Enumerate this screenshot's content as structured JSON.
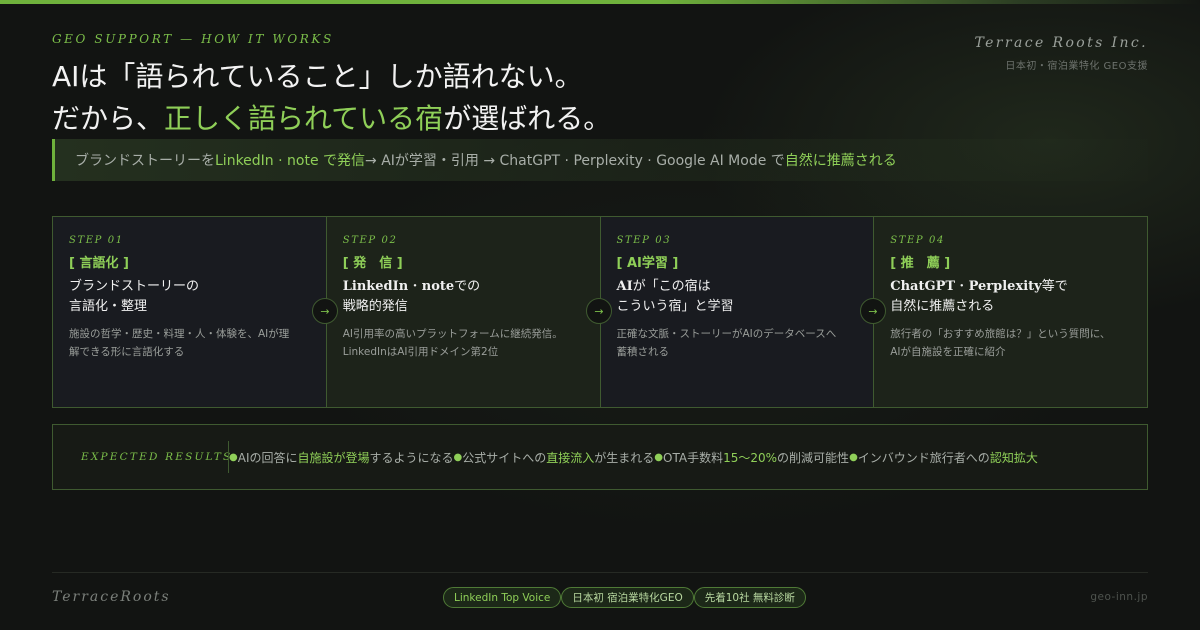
{
  "header": {
    "eyebrow": "GEO SUPPORT — HOW IT WORKS",
    "brand_name": "Terrace Roots Inc.",
    "brand_sub": "日本初・宿泊業特化 GEO支援",
    "headline_line1": "AIは「語られていること」しか語れない。",
    "headline_line2_pre": "だから、",
    "headline_line2_accent": "正しく語られている宿",
    "headline_line2_post": "が選ばれる。"
  },
  "banner": {
    "p1": "ブランドストーリーを ",
    "p2": "LinkedIn · note で発信",
    "p3": " → AIが学習・引用 → ChatGPT · Perplexity · Google AI Mode で",
    "p4": "自然に推薦される"
  },
  "steps": [
    {
      "num": "STEP 01",
      "tag": "[ 言語化 ]",
      "title_l1": "ブランドストーリーの",
      "title_l2": "言語化・整理",
      "desc_l1": "施設の哲学・歴史・料理・人・体験を、AIが理",
      "desc_l2": "解できる形に言語化する"
    },
    {
      "num": "STEP 02",
      "tag": "[ 発　信 ]",
      "title_bold": "LinkedIn · note",
      "title_l1": "での",
      "title_l2": "戦略的発信",
      "desc_l1": "AI引用率の高いプラットフォームに継続発信。",
      "desc_l2": "LinkedInはAI引用ドメイン第2位"
    },
    {
      "num": "STEP 03",
      "tag": "[ AI学習 ]",
      "title_bold": "AI",
      "title_l1": "が「この宿は",
      "title_l2": "こういう宿」と学習",
      "desc_l1": "正確な文脈・ストーリーがAIのデータベースへ",
      "desc_l2": "蓄積される"
    },
    {
      "num": "STEP 04",
      "tag": "[ 推　薦 ]",
      "title_bold": "ChatGPT · Perplexity",
      "title_l1": "等で",
      "title_l2": "自然に推薦される",
      "desc_l1": "旅行者の「おすすめ旅館は？」という質問に、",
      "desc_l2": "AIが自施設を正確に紹介"
    }
  ],
  "arrow_glyph": "→",
  "results": {
    "label": "EXPECTED RESULTS",
    "dot": "●",
    "items": [
      {
        "pre": "AIの回答に",
        "accent": "自施設が登場",
        "post": "するようになる"
      },
      {
        "pre": "公式サイトへの",
        "accent": "直接流入",
        "post": "が生まれる"
      },
      {
        "pre": "OTA手数料",
        "accent": "15〜20%",
        "post": "の削減可能性"
      },
      {
        "pre": "インバウンド旅行者への",
        "accent": "認知拡大",
        "post": ""
      }
    ]
  },
  "footer": {
    "brand": "TerraceRoots",
    "badges": [
      "LinkedIn Top Voice",
      "日本初 宿泊業特化GEO",
      "先着10社 無料診断"
    ],
    "url": "geo-inn.jp"
  },
  "colors": {
    "accent": "#8fcf58",
    "background": "#121412",
    "border": "#3f5a30"
  }
}
